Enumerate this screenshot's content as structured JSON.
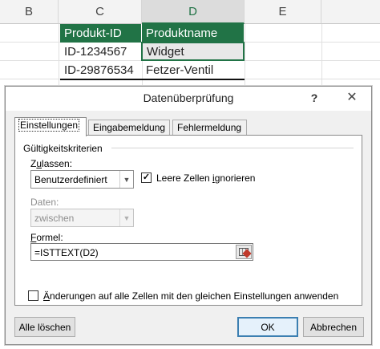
{
  "sheet": {
    "columns": [
      "B",
      "C",
      "D",
      "E"
    ],
    "table_headers": [
      "Produkt-ID",
      "Produktname"
    ],
    "rows": [
      [
        "ID-1234567",
        "Widget"
      ],
      [
        "ID-29876534",
        "Fetzer-Ventil"
      ]
    ],
    "colors": {
      "header_bg": "#217346",
      "accent": "#217346"
    }
  },
  "dialog": {
    "title": "Datenüberprüfung",
    "help": "?",
    "close": "✕",
    "tabs": [
      {
        "label": "Einstellungen",
        "active": true
      },
      {
        "label": "Eingabemeldung",
        "active": false
      },
      {
        "label": "Fehlermeldung",
        "active": false
      }
    ],
    "group_label": "Gültigkeitskriterien",
    "allow": {
      "label_pre": "Z",
      "label_key": "u",
      "label_post": "lassen:",
      "value": "Benutzerdefiniert",
      "arrow_icon": "chevron-down-icon"
    },
    "ignore_blank": {
      "checked": true,
      "label_pre": "Leere Zellen ",
      "label_key": "i",
      "label_post": "gnorieren"
    },
    "data": {
      "label": "Daten:",
      "value": "zwischen",
      "enabled": false
    },
    "formula": {
      "label_pre": "",
      "label_key": "F",
      "label_post": "ormel:",
      "value": "=ISTTEXT(D2)",
      "range_icon": "range-select-icon"
    },
    "apply_all": {
      "checked": false,
      "label_pre": "",
      "label_key": "Ä",
      "label_post": "nderungen auf alle Zellen mit den gleichen Einstellungen anwenden"
    },
    "buttons": {
      "clear_all": "Alle löschen",
      "ok": "OK",
      "cancel": "Abbrechen"
    }
  }
}
